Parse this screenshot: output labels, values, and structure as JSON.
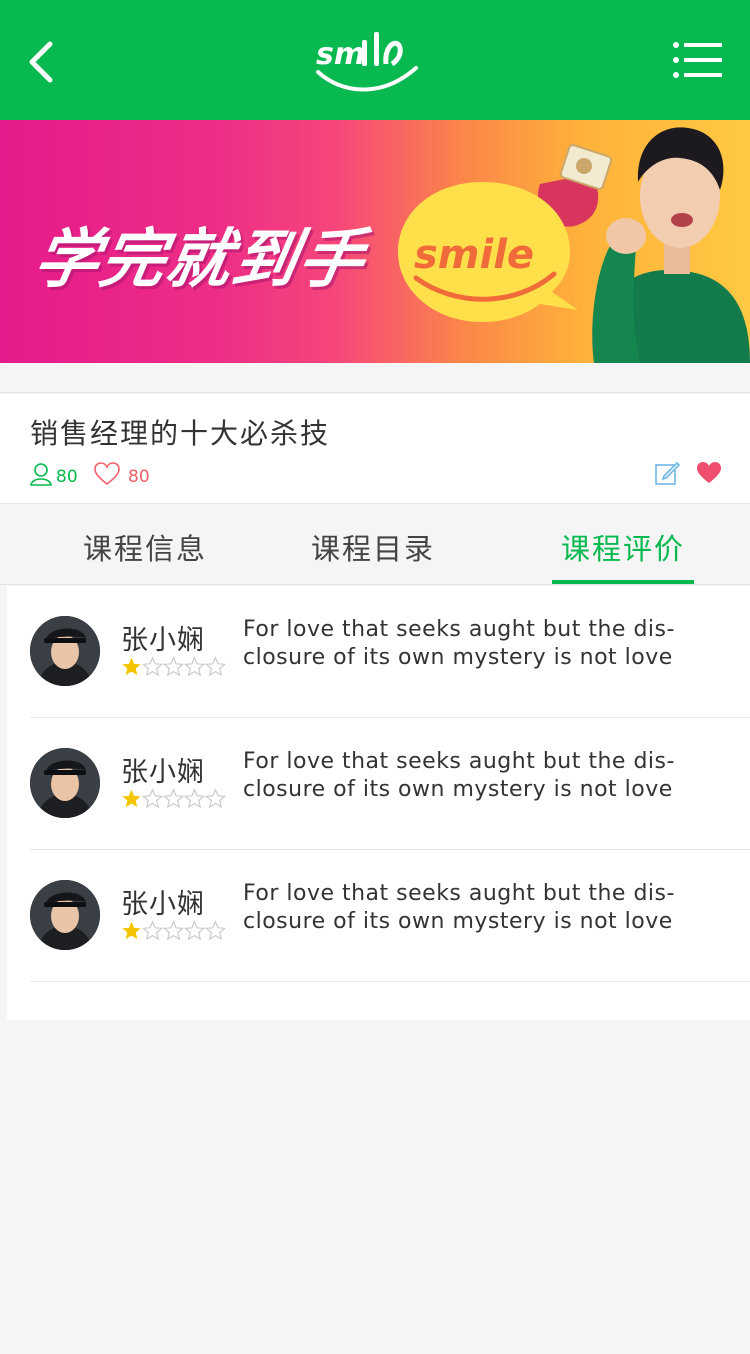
{
  "header": {
    "back_icon": "chevron-left-icon",
    "logo": "smile",
    "menu_icon": "list-menu-icon",
    "bg_color": "#07b94e"
  },
  "banner": {
    "headline": "学完就到手",
    "logo": "smile"
  },
  "course": {
    "title": "销售经理的十大必杀技",
    "learners": "80",
    "likes": "80",
    "edit_icon": "edit-icon",
    "favorite_icon": "heart-icon"
  },
  "tabs": [
    {
      "label": "课程信息",
      "active": false
    },
    {
      "label": "课程目录",
      "active": false
    },
    {
      "label": "课程评价",
      "active": true
    }
  ],
  "reviews": [
    {
      "name": "张小娴",
      "rating": 1,
      "max_rating": 5,
      "comment": "For love that seeks aught but the dis-closure of its own mystery is not love"
    },
    {
      "name": "张小娴",
      "rating": 1,
      "max_rating": 5,
      "comment": "For love that seeks aught but the dis-closure of its own mystery is not love"
    },
    {
      "name": "张小娴",
      "rating": 1,
      "max_rating": 5,
      "comment": "For love that seeks aught but the dis-closure of its own mystery is not love"
    }
  ],
  "colors": {
    "accent": "#07b94e",
    "like": "#f0606a",
    "star_filled": "#f5c400",
    "star_empty": "#c8c8c8"
  }
}
